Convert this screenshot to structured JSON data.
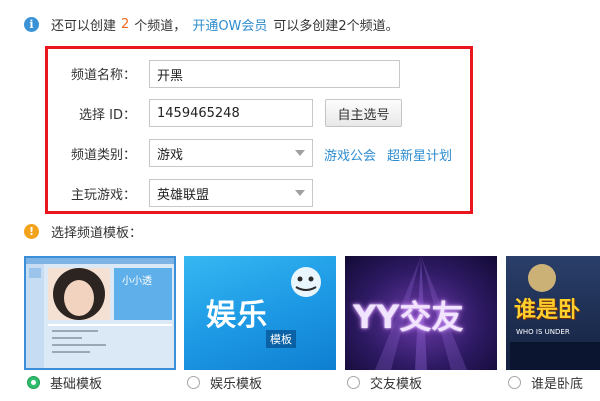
{
  "info": {
    "prefix": "还可以创建",
    "count": "2",
    "suffix": "个频道，",
    "link": "开通OW会员",
    "tail": "可以多创建2个频道。",
    "icon": "info-icon"
  },
  "form": {
    "name_label": "频道名称：",
    "name_value": "开黑",
    "id_label": "选择 ID：",
    "id_value": "1459465248",
    "id_button": "自主选号",
    "category_label": "频道类别：",
    "category_value": "游戏",
    "category_link1": "游戏公会",
    "category_link2": "超新星计划",
    "game_label": "主玩游戏：",
    "game_value": "英雄联盟"
  },
  "templates": {
    "title": "选择频道模板：",
    "icon": "warning-icon",
    "items": [
      {
        "label": "基础模板",
        "selected": true,
        "thumb_text": "小小透"
      },
      {
        "label": "娱乐模板",
        "selected": false,
        "thumb_text": "娱乐",
        "thumb_sub": "模板"
      },
      {
        "label": "交友模板",
        "selected": false,
        "thumb_text": "YY交友"
      },
      {
        "label": "谁是卧底",
        "selected": false,
        "thumb_text": "谁是卧",
        "thumb_sub": "WHO IS UNDER"
      }
    ]
  },
  "colors": {
    "accent_blue": "#2d8ccf",
    "highlight_orange": "#f26a1b",
    "frame_red": "#e9161d",
    "selected_green": "#2fbe6e"
  }
}
